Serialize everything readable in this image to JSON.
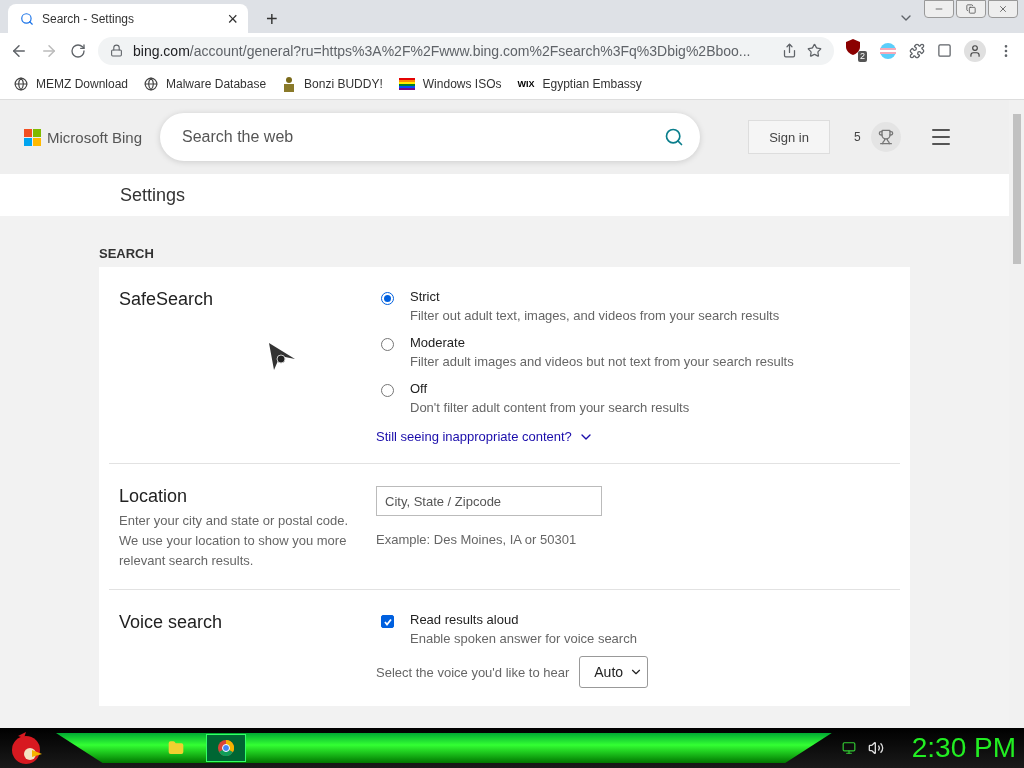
{
  "browser": {
    "tab": {
      "title": "Search - Settings",
      "close": "×"
    },
    "new_tab": "+",
    "address": {
      "host": "bing.com",
      "path": "/account/general?ru=https%3A%2F%2Fwww.bing.com%2Fsearch%3Fq%3Dbig%2Bboo..."
    },
    "extension_badge": "2",
    "bookmarks": [
      {
        "label": "MEMZ Download",
        "kind": "globe"
      },
      {
        "label": "Malware Database",
        "kind": "globe"
      },
      {
        "label": "Bonzi BUDDY!",
        "kind": "figure"
      },
      {
        "label": "Windows ISOs",
        "kind": "rainbow"
      },
      {
        "label": "Egyptian Embassy",
        "kind": "wix",
        "mark": "WIX"
      }
    ]
  },
  "header": {
    "logo": "Microsoft Bing",
    "search": {
      "placeholder": "Search the web"
    },
    "sign_in": "Sign in",
    "points": "5"
  },
  "page_title": "Settings",
  "section_label": "SEARCH",
  "safesearch": {
    "title": "SafeSearch",
    "options": [
      {
        "label": "Strict",
        "description": "Filter out adult text, images, and videos from your search results",
        "selected": true
      },
      {
        "label": "Moderate",
        "description": "Filter adult images and videos but not text from your search results",
        "selected": false
      },
      {
        "label": "Off",
        "description": "Don't filter adult content from your search results",
        "selected": false
      }
    ],
    "link": "Still seeing inappropriate content?"
  },
  "location": {
    "title": "Location",
    "description": "Enter your city and state or postal code. We use your location to show you more relevant search results.",
    "placeholder": "City, State / Zipcode",
    "example": "Example: Des Moines, IA or 50301"
  },
  "voice": {
    "title": "Voice search",
    "option": {
      "label": "Read results aloud",
      "description": "Enable spoken answer for voice search",
      "checked": true
    },
    "voice_label": "Select the voice you'd like to hear",
    "voice_value": "Auto"
  },
  "taskbar": {
    "clock": "2:30 PM"
  }
}
